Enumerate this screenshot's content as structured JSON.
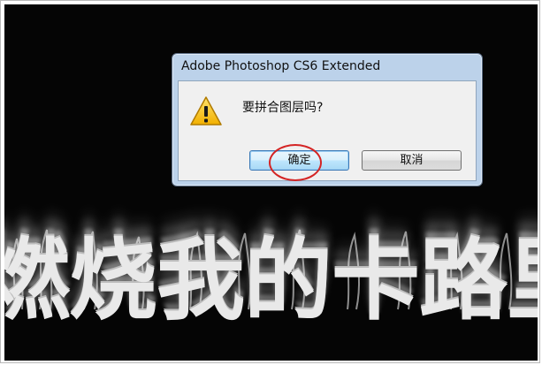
{
  "dialog": {
    "title": "Adobe Photoshop CS6 Extended",
    "message": "要拼合图层吗?",
    "ok_label": "确定",
    "cancel_label": "取消"
  },
  "background": {
    "fire_text": "燃烧我的卡路里"
  },
  "icons": {
    "warning": "warning-icon"
  },
  "colors": {
    "annotation": "#d42424",
    "canvas": "#050505",
    "dialog_frame": "#bcd2ea"
  }
}
